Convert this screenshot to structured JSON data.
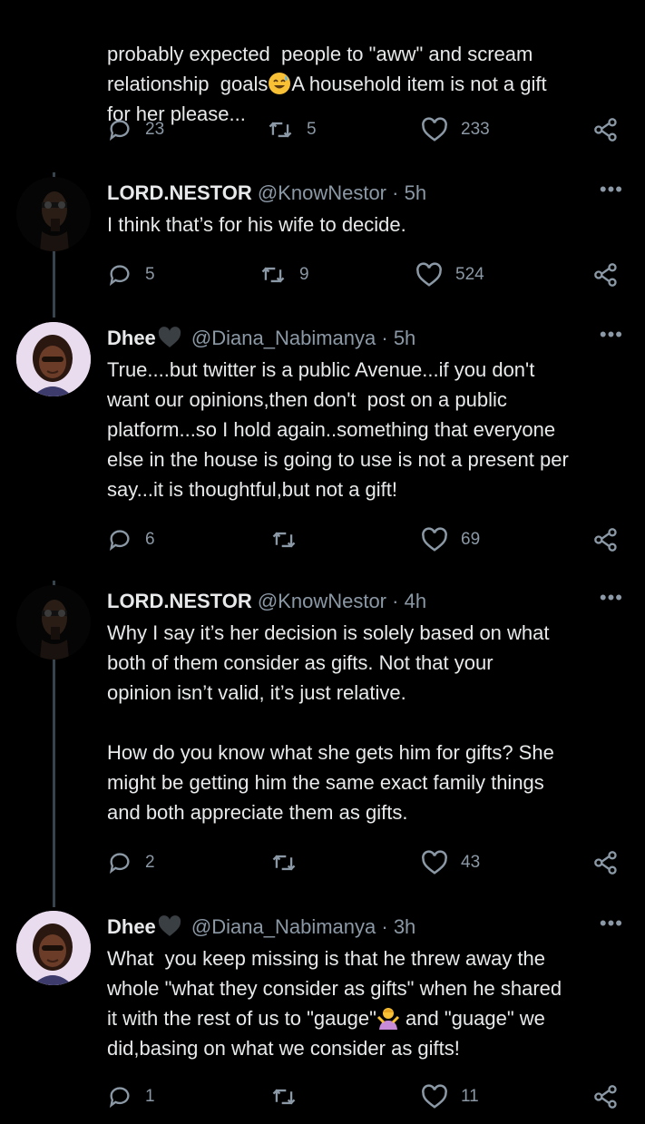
{
  "top_tweet": {
    "text_line1": "probably expected  people to \"aww\" and scream",
    "text_line2a": "relationship  goals",
    "text_line2b": "A household item is not a gift",
    "text_line3": "for her please...",
    "replies": "23",
    "retweets": "5",
    "likes": "233"
  },
  "tweets": [
    {
      "name": "LORD.NESTOR",
      "handle": "@KnowNestor",
      "time": "· 5h",
      "text": "I think that’s for his wife to decide.",
      "replies": "5",
      "retweets": "9",
      "likes": "524"
    },
    {
      "name": "Dhee",
      "handle": "@Diana_Nabimanya",
      "time": "· 5h",
      "text": "True....but twitter is a public Avenue...if you don't\nwant our opinions,then don't  post on a public\nplatform...so I hold again..something that everyone\nelse in the house is going to use is not a present per\nsay...it is thoughtful,but not a gift!",
      "replies": "6",
      "retweets": "",
      "likes": "69"
    },
    {
      "name": "LORD.NESTOR",
      "handle": "@KnowNestor",
      "time": "· 4h",
      "text": "Why I say it’s her decision is solely based on what\nboth of them consider as gifts. Not that your\nopinion isn’t valid, it’s just relative.\n\nHow do you know what she gets him for gifts? She\nmight be getting him the same exact family things\nand both appreciate them as gifts.",
      "replies": "2",
      "retweets": "",
      "likes": "43"
    },
    {
      "name": "Dhee",
      "handle": "@Diana_Nabimanya",
      "time": "· 3h",
      "text_a": "What  you keep missing is that he threw away the\nwhole \"what they consider as gifts\" when he shared\nit with the rest of us to \"gauge\"",
      "text_b": " and \"guage\" we\ndid,basing on what we consider as gifts!",
      "replies": "1",
      "retweets": "",
      "likes": "11"
    }
  ],
  "more_label": "•••",
  "colors": {
    "background": "#000000",
    "text": "#e7e9ea",
    "muted": "#8b98a5",
    "thread_line": "#38444d"
  },
  "icons": [
    "reply-icon",
    "retweet-icon",
    "like-icon",
    "share-icon",
    "heart-badge-icon",
    "more-icon"
  ]
}
